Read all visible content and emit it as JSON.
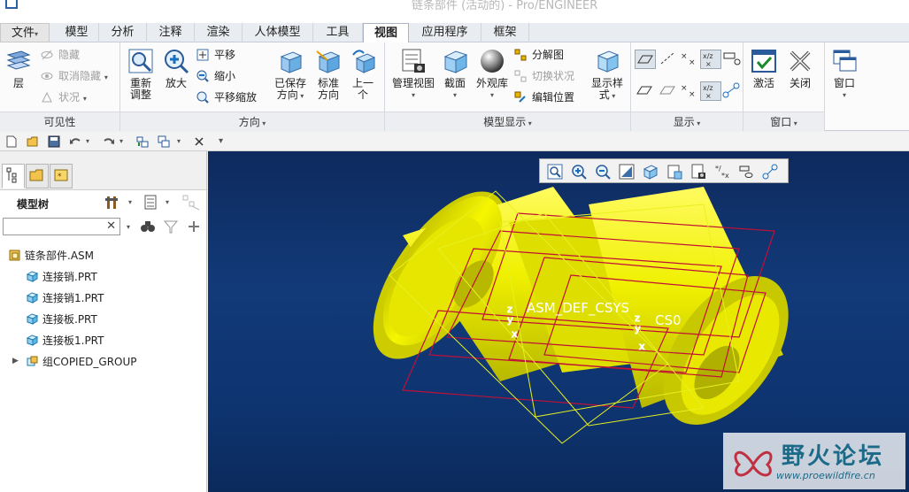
{
  "window": {
    "title": "链条部件 (活动的) - Pro/ENGINEER"
  },
  "tabs": [
    {
      "label": "文件",
      "dropdown": "▾"
    },
    {
      "label": "模型"
    },
    {
      "label": "分析"
    },
    {
      "label": "注释"
    },
    {
      "label": "渲染"
    },
    {
      "label": "人体模型"
    },
    {
      "label": "工具"
    },
    {
      "label": "视图",
      "active": true
    },
    {
      "label": "应用程序"
    },
    {
      "label": "框架"
    }
  ],
  "ribbon": {
    "visibility": {
      "label": "可见性",
      "layer": "层",
      "hide": "隐藏",
      "unhide": "取消隐藏",
      "status": "状况"
    },
    "orientation": {
      "label": "方向",
      "refit_line1": "重新",
      "refit_line2": "调整",
      "zoom_in": "放大",
      "pan": "平移",
      "zoom_out": "缩小",
      "pan_zoom": "平移缩放",
      "saved_line1": "已保存",
      "saved_line2": "方向",
      "standard_line1": "标准",
      "standard_line2": "方向",
      "previous_line1": "上一",
      "previous_line2": "个"
    },
    "model_display": {
      "label": "模型显示",
      "manage_views": "管理视图",
      "section": "截面",
      "appearance": "外观库",
      "explode": "分解图",
      "toggle_status": "切换状况",
      "edit_position": "编辑位置",
      "display_style_line1": "显示样",
      "display_style_line2": "式"
    },
    "show": {
      "label": "显示"
    },
    "window": {
      "label": "窗口",
      "activate": "激活",
      "close": "关闭",
      "window": "窗口"
    }
  },
  "left_panel": {
    "tree_title": "模型树",
    "search_placeholder": "",
    "items": [
      {
        "name": "链条部件.ASM",
        "type": "asm"
      },
      {
        "name": "连接销.PRT",
        "type": "prt"
      },
      {
        "name": "连接销1.PRT",
        "type": "prt"
      },
      {
        "name": "连接板.PRT",
        "type": "prt"
      },
      {
        "name": "连接板1.PRT",
        "type": "prt"
      },
      {
        "name": "组COPIED_GROUP",
        "type": "group"
      }
    ]
  },
  "viewport": {
    "labels": {
      "csys1": "ASM_DEF_CSYS",
      "csys2": "CS0"
    },
    "colors": {
      "model": "#f0f000",
      "datum_plane": "#c01038",
      "datum_outline": "#e8f020",
      "background_top": "#0e2a5e",
      "background_bottom": "#0b2a5c"
    }
  },
  "watermark": {
    "text": "野火论坛",
    "url": "www.proewildfire.cn"
  }
}
